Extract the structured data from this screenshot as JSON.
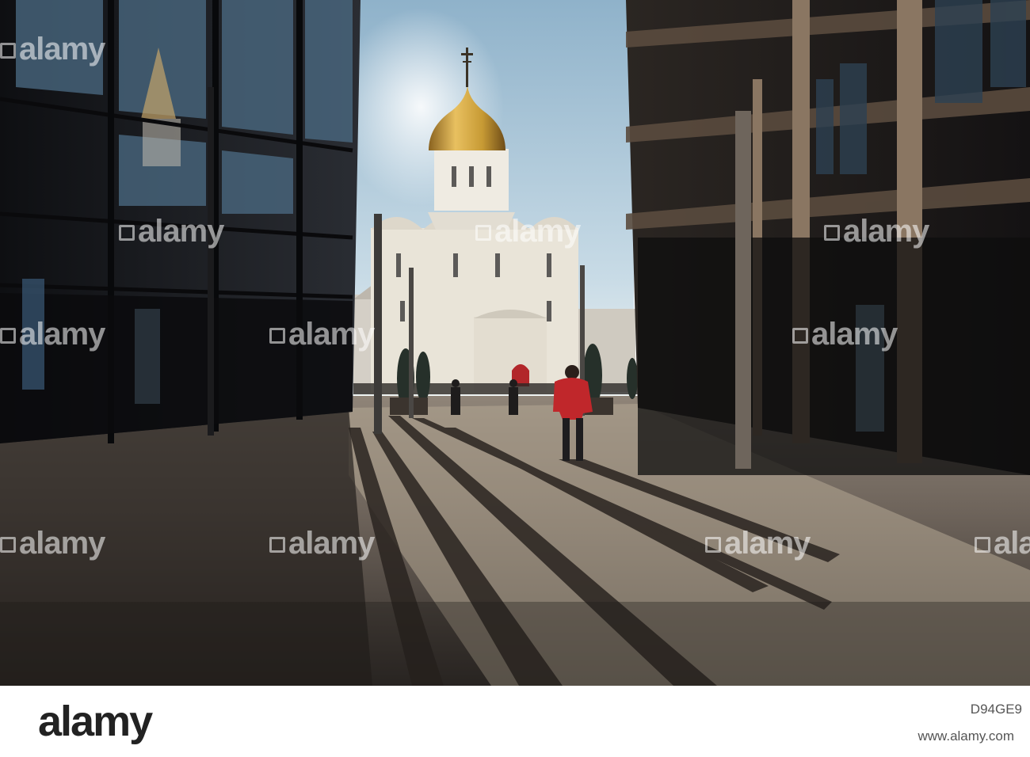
{
  "watermark": {
    "brand": "alamy",
    "image_id": "D94GE9",
    "url": "www.alamy.com"
  },
  "scene": {
    "colors": {
      "sky": "#a9c3d6",
      "dome_gold": "#c79a34",
      "church_white": "#e9e4d8",
      "pavement_light": "#9a8e80",
      "pavement_dark": "#3b3531",
      "buildings": "#1a1a1c",
      "jacket_red": "#c0272b"
    }
  }
}
